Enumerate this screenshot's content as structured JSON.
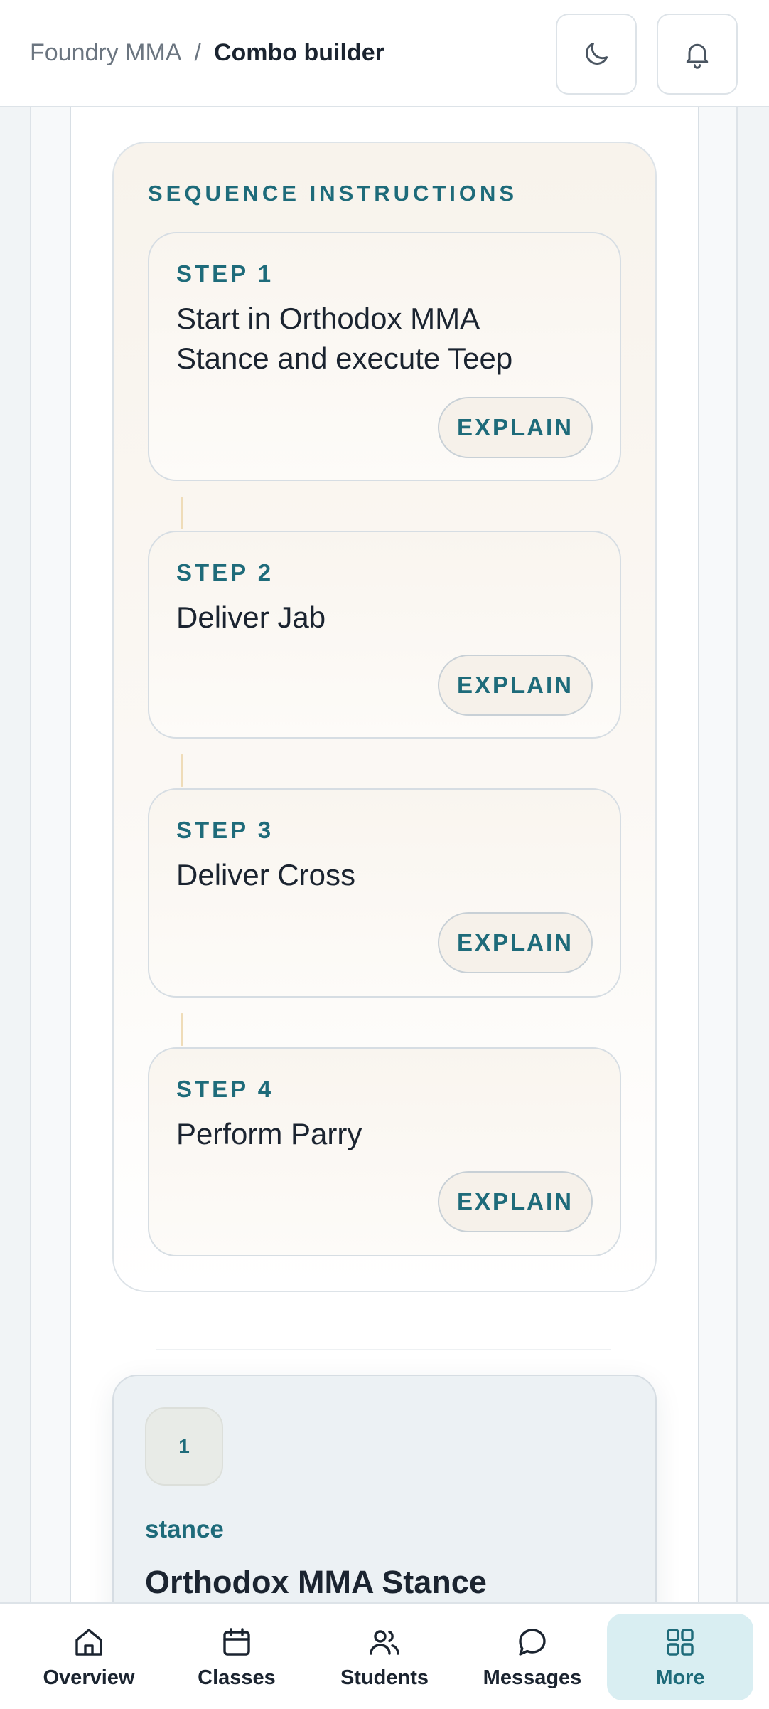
{
  "header": {
    "app_name": "Foundry MMA",
    "separator": "/",
    "page_title": "Combo builder",
    "theme_button": "moon-icon",
    "notifications_button": "bell-icon"
  },
  "sequence": {
    "title": "SEQUENCE INSTRUCTIONS",
    "steps": [
      {
        "label": "STEP 1",
        "text": "Start in Orthodox MMA Stance and execute Teep",
        "action": "EXPLAIN"
      },
      {
        "label": "STEP 2",
        "text": "Deliver Jab",
        "action": "EXPLAIN"
      },
      {
        "label": "STEP 3",
        "text": "Deliver Cross",
        "action": "EXPLAIN"
      },
      {
        "label": "STEP 4",
        "text": "Perform Parry",
        "action": "EXPLAIN"
      }
    ]
  },
  "move_card": {
    "number": "1",
    "kind": "stance",
    "name": "Orthodox MMA Stance"
  },
  "tabbar": {
    "items": [
      {
        "label": "Overview",
        "icon": "home-icon"
      },
      {
        "label": "Classes",
        "icon": "calendar-icon"
      },
      {
        "label": "Students",
        "icon": "users-icon"
      },
      {
        "label": "Messages",
        "icon": "chat-bubble-icon"
      },
      {
        "label": "More",
        "icon": "grid-icon",
        "active": true
      }
    ]
  },
  "colors": {
    "accent": "#1e6b7a",
    "text": "#1b2430",
    "active_tab_bg": "#d9eef2"
  }
}
